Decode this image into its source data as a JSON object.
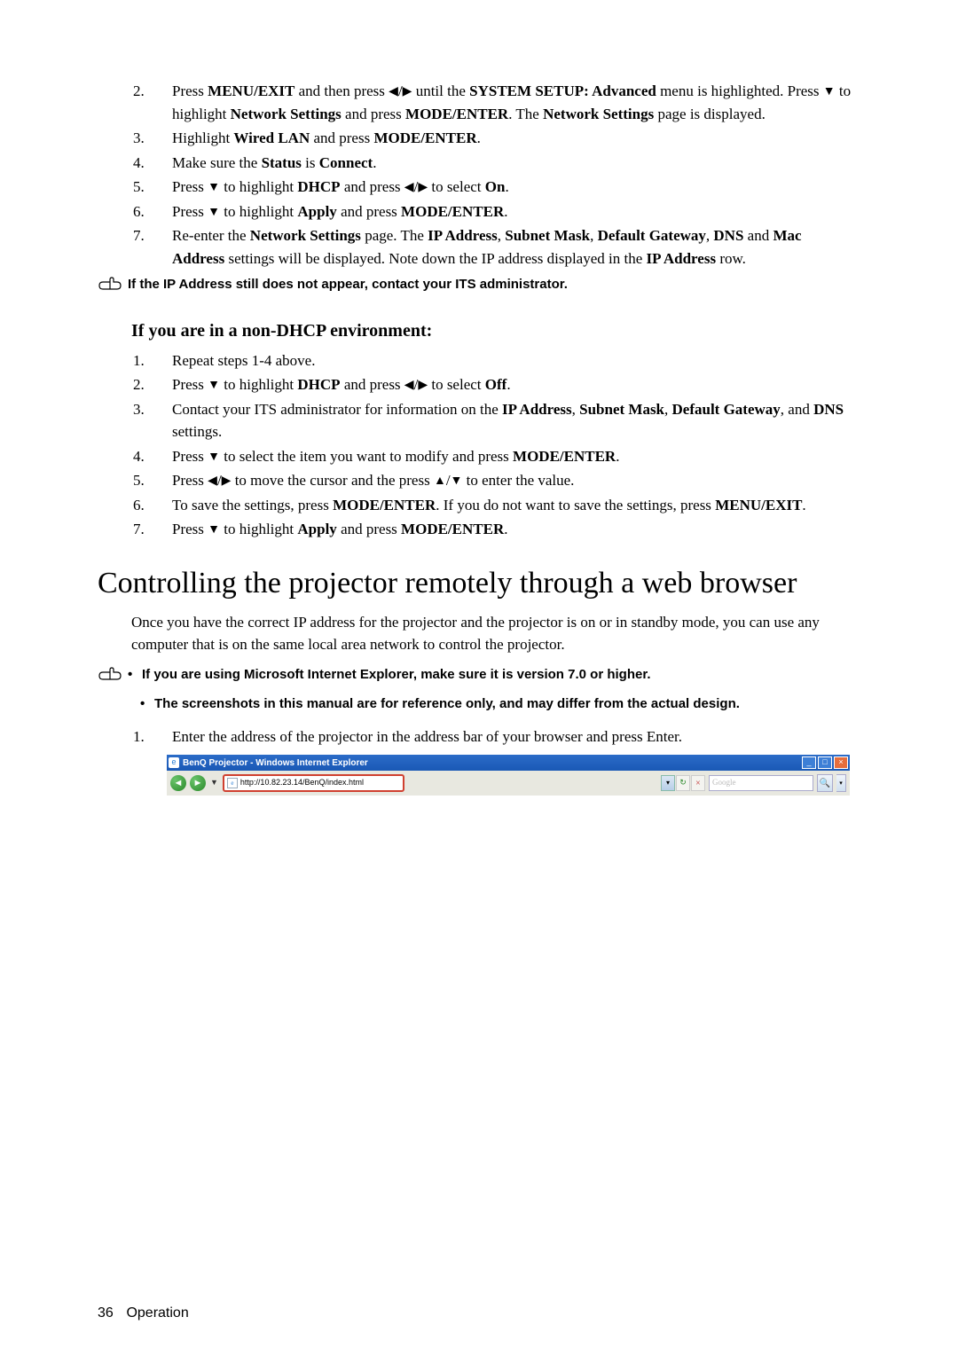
{
  "steps_a": [
    {
      "num": "2.",
      "html": "Press <b>MENU/EXIT</b> and then press ◀/▶ until the <b>SYSTEM SETUP: Advanced</b> menu is highlighted. Press ▼ to highlight <b>Network Settings</b> and press <b>MODE/ENTER</b>. The <b>Network Settings</b> page is displayed."
    },
    {
      "num": "3.",
      "html": "Highlight <b>Wired LAN</b> and press <b>MODE/ENTER</b>."
    },
    {
      "num": "4.",
      "html": "Make sure the <b>Status</b> is <b>Connect</b>."
    },
    {
      "num": "5.",
      "html": "Press ▼ to highlight <b>DHCP</b> and press ◀/▶ to select <b>On</b>."
    },
    {
      "num": "6.",
      "html": "Press ▼ to highlight <b>Apply</b> and press <b>MODE/ENTER</b>."
    },
    {
      "num": "7.",
      "html": "Re-enter the <b>Network Settings</b> page. The <b>IP Address</b>, <b>Subnet Mask</b>, <b>Default Gateway</b>, <b>DNS</b> and <b>Mac Address</b> settings will be displayed. Note down the IP address displayed in the <b>IP Address</b> row."
    }
  ],
  "note1": "If the IP Address still does not appear, contact your ITS administrator.",
  "sub_heading": "If you are in a non-DHCP environment:",
  "steps_b": [
    {
      "num": "1.",
      "html": "Repeat steps 1-4 above."
    },
    {
      "num": "2.",
      "html": "Press ▼ to highlight <b>DHCP</b> and press ◀/▶ to select <b>Off</b>."
    },
    {
      "num": "3.",
      "html": "Contact your ITS administrator for information on the <b>IP Address</b>, <b>Subnet Mask</b>, <b>Default Gateway</b>, and <b>DNS</b> settings."
    },
    {
      "num": "4.",
      "html": "Press ▼ to select the item you want to modify and press <b>MODE/ENTER</b>."
    },
    {
      "num": "5.",
      "html": "Press ◀/▶ to move the cursor and the press ▲/▼ to enter the value."
    },
    {
      "num": "6.",
      "html": "To save the settings, press <b>MODE/ENTER</b>. If you do not want to save the settings, press <b>MENU/EXIT</b>."
    },
    {
      "num": "7.",
      "html": "Press ▼ to highlight <b>Apply</b> and press <b>MODE/ENTER</b>."
    }
  ],
  "h1": "Controlling the projector remotely through a web browser",
  "intro": "Once you have the correct IP address for the projector and the projector is on or in standby mode, you can use any computer that is on the same local area network to control the projector.",
  "note2_bullets": [
    "If you are using Microsoft Internet Explorer, make sure it is version 7.0 or higher.",
    "The screenshots in this manual are for reference only, and may differ from the actual design."
  ],
  "step_enter": {
    "num": "1.",
    "text": "Enter the address of the projector in the address bar of your browser and press Enter."
  },
  "ie": {
    "title": "BenQ Projector - Windows Internet Explorer",
    "url": "http://10.82.23.14/BenQ/index.html",
    "search_placeholder": "Google"
  },
  "footer": {
    "page": "36",
    "section": "Operation"
  }
}
